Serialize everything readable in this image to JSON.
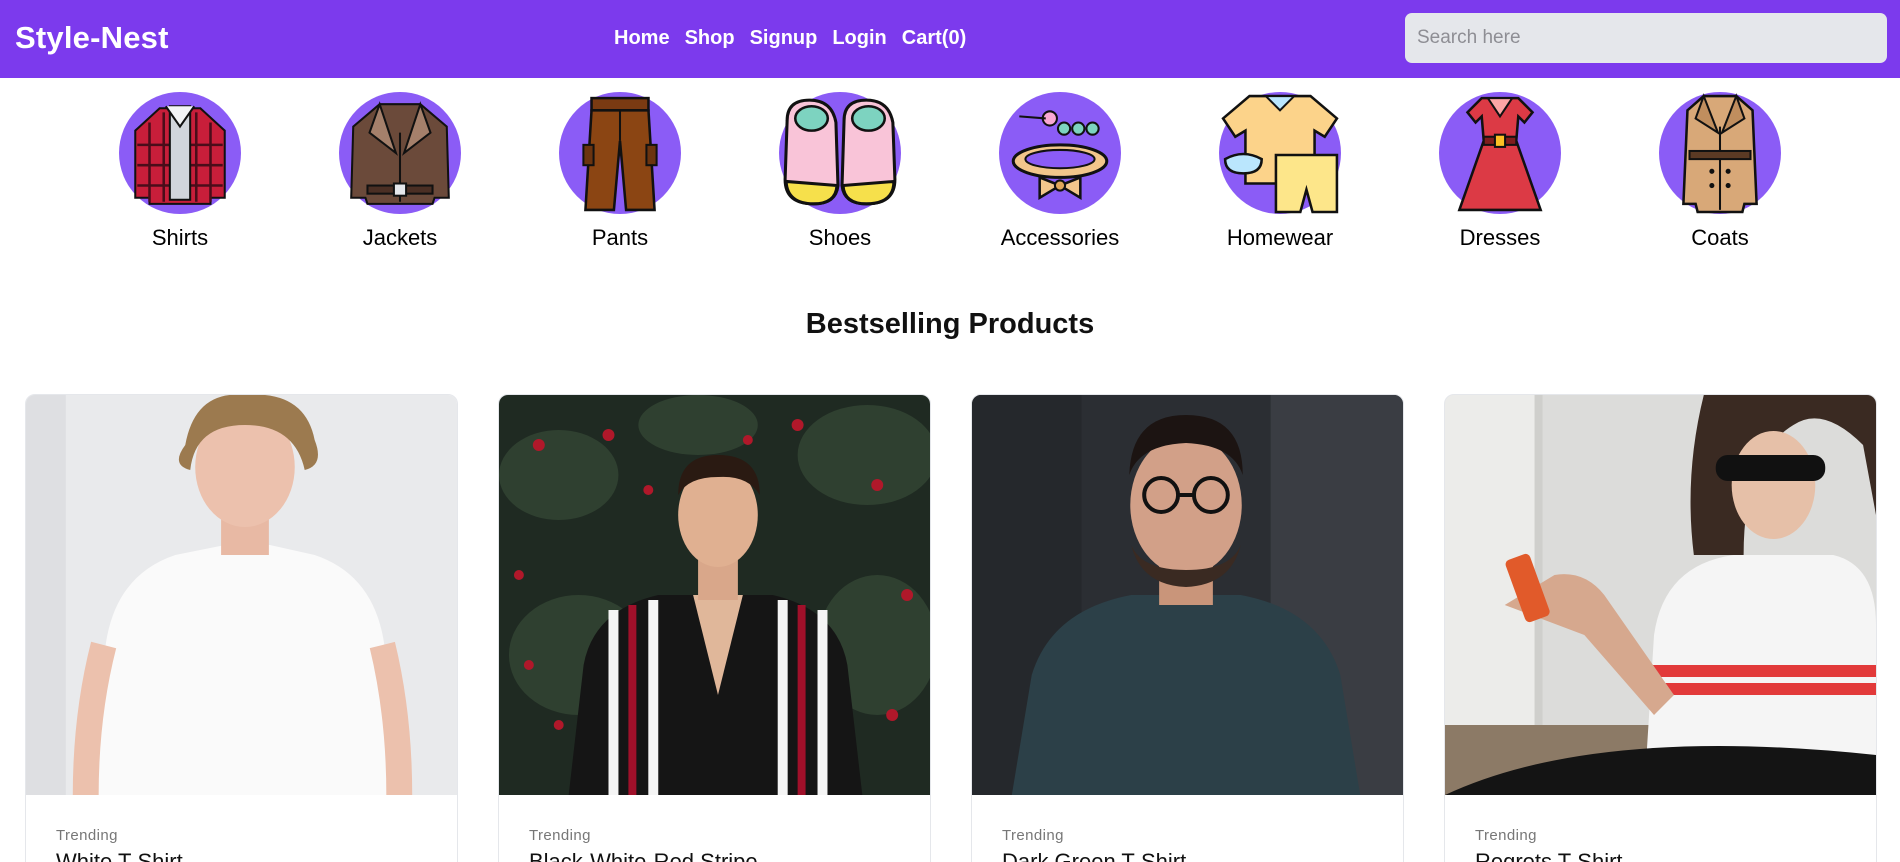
{
  "brand": "Style-Nest",
  "nav": {
    "home": "Home",
    "shop": "Shop",
    "signup": "Signup",
    "login": "Login",
    "cart": "Cart(0)"
  },
  "search": {
    "placeholder": "Search here",
    "value": ""
  },
  "categories": [
    {
      "label": "Shirts",
      "icon": "shirt-icon"
    },
    {
      "label": "Jackets",
      "icon": "jacket-icon"
    },
    {
      "label": "Pants",
      "icon": "pants-icon"
    },
    {
      "label": "Shoes",
      "icon": "shoes-icon"
    },
    {
      "label": "Accessories",
      "icon": "accessories-icon"
    },
    {
      "label": "Homewear",
      "icon": "homewear-icon"
    },
    {
      "label": "Dresses",
      "icon": "dress-icon"
    },
    {
      "label": "Coats",
      "icon": "coat-icon"
    }
  ],
  "section_title": "Bestselling Products",
  "products": [
    {
      "tag": "Trending",
      "name": "White T-Shirt"
    },
    {
      "tag": "Trending",
      "name": "Black-White-Red Stripe"
    },
    {
      "tag": "Trending",
      "name": "Dark Green T-Shirt"
    },
    {
      "tag": "Trending",
      "name": "Regrets T-Shirt"
    }
  ],
  "colors": {
    "brand": "#7c3aed",
    "category_circle": "#8b5cf6",
    "search_bg": "#e5e7eb"
  }
}
